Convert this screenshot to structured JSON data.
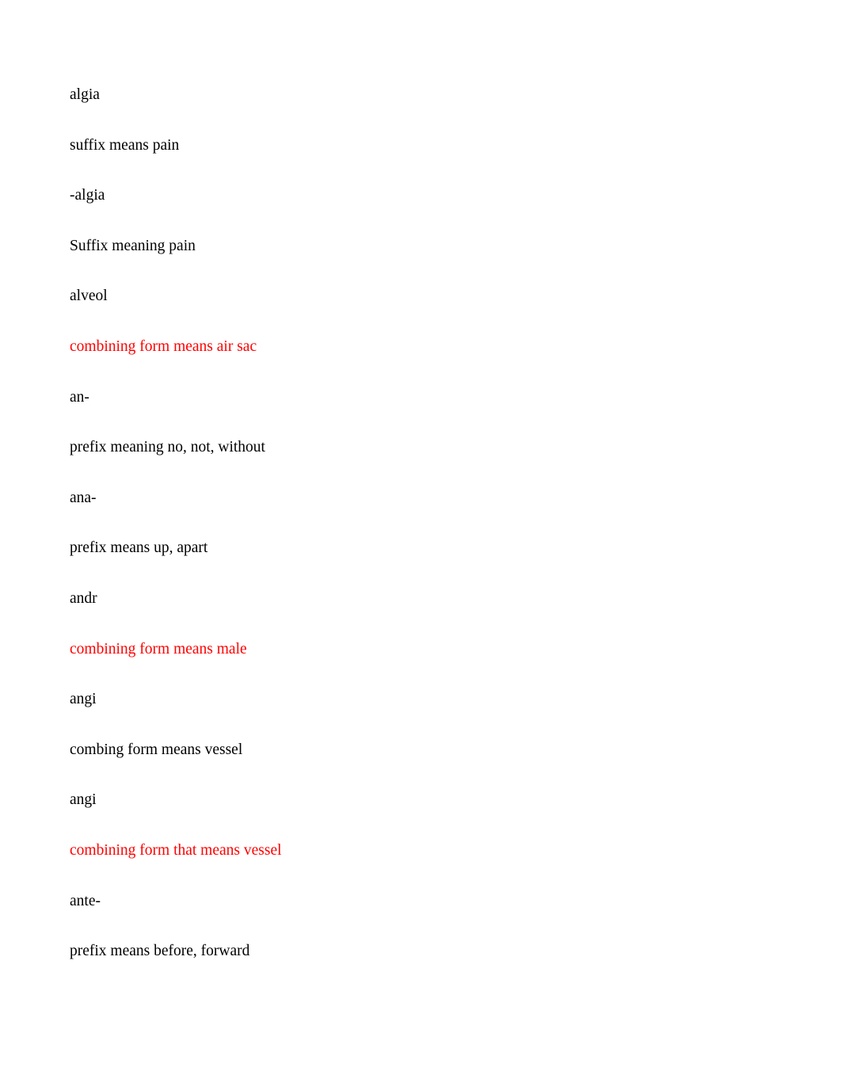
{
  "document": {
    "lines": [
      {
        "text": "algia",
        "color": "black"
      },
      {
        "text": "suffix means pain",
        "color": "black"
      },
      {
        "text": "-algia",
        "color": "black"
      },
      {
        "text": "Suffix meaning pain",
        "color": "black"
      },
      {
        "text": "alveol",
        "color": "black"
      },
      {
        "text": "combining form means air sac",
        "color": "red"
      },
      {
        "text": "an-",
        "color": "black"
      },
      {
        "text": "prefix meaning no, not, without",
        "color": "black"
      },
      {
        "text": "ana-",
        "color": "black"
      },
      {
        "text": "prefix means up, apart",
        "color": "black"
      },
      {
        "text": "andr",
        "color": "black"
      },
      {
        "text": "combining form means male",
        "color": "red"
      },
      {
        "text": "angi",
        "color": "black"
      },
      {
        "text": "combing form means vessel",
        "color": "black"
      },
      {
        "text": "angi",
        "color": "black"
      },
      {
        "text": "combining form that means vessel",
        "color": "red"
      },
      {
        "text": "ante-",
        "color": "black"
      },
      {
        "text": "prefix means before, forward",
        "color": "black"
      }
    ],
    "colors": {
      "text": "#000000",
      "highlight": "#ff0000",
      "background": "#ffffff"
    }
  }
}
